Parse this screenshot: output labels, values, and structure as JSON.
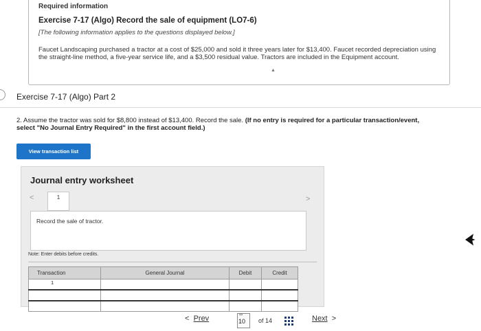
{
  "info": {
    "heading": "Required information",
    "exercise_title": "Exercise 7-17 (Algo) Record the sale of equipment (LO7-6)",
    "note": "[The following information applies to the questions displayed below.]",
    "paragraph": "Faucet Landscaping purchased a tractor at a cost of $25,000 and sold it three years later for $13,400. Faucet recorded depreciation using the straight-line method, a five-year service life, and a $3,500 residual value. Tractors are included in the Equipment account."
  },
  "part": {
    "title": "Exercise 7-17 (Algo) Part 2"
  },
  "question": {
    "text": "2. Assume the tractor was sold for $8,800 instead of $13,400. Record the sale. ",
    "bold": "(If no entry is required for a particular transaction/event, select \"No Journal Entry Required\" in the first account field.)"
  },
  "buttons": {
    "view_transaction_list": "View transaction list"
  },
  "worksheet": {
    "title": "Journal entry worksheet",
    "prev_arrow": "<",
    "next_arrow": ">",
    "current_tab": "1",
    "description": "Record the sale of tractor.",
    "note": "Note: Enter debits before credits.",
    "columns": {
      "transaction": "Transaction",
      "general_journal": "General Journal",
      "debit": "Debit",
      "credit": "Credit"
    },
    "rows": [
      {
        "transaction": "1",
        "account": "",
        "debit": "",
        "credit": ""
      },
      {
        "transaction": "",
        "account": "",
        "debit": "",
        "credit": ""
      },
      {
        "transaction": "",
        "account": "",
        "debit": "",
        "credit": ""
      }
    ]
  },
  "pager": {
    "prev_label": "Prev",
    "current_page": "10",
    "of_total": "of 14",
    "next_label": "Next"
  },
  "colors": {
    "primary_button": "#1e74c9",
    "grid_icon": "#1f3a78"
  }
}
